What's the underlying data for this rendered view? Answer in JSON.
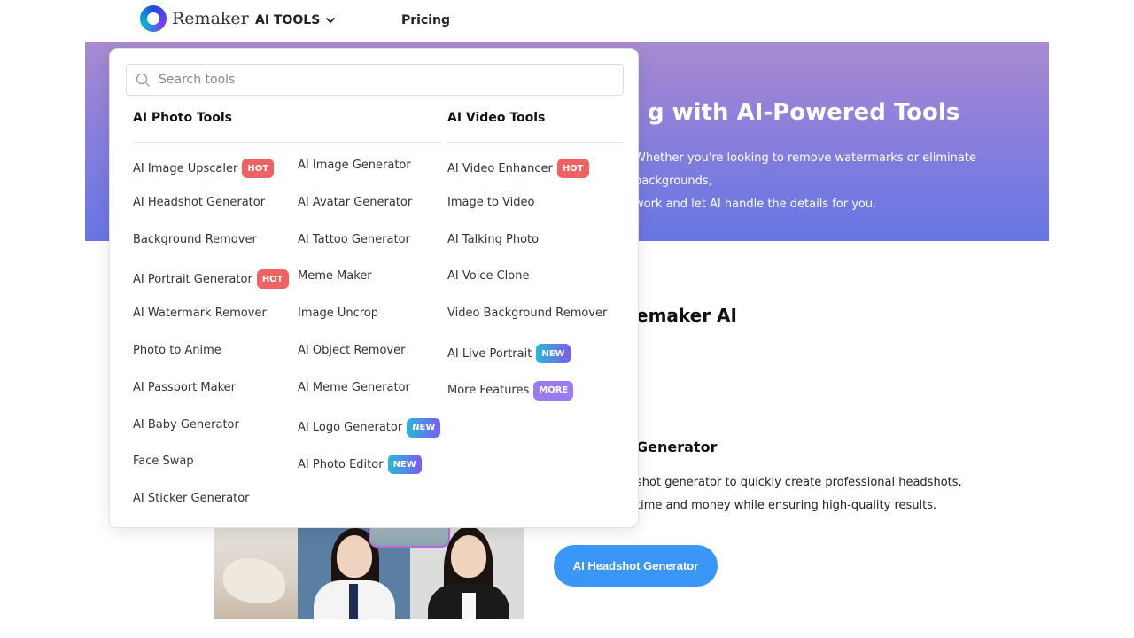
{
  "header": {
    "logo_text": "Remaker",
    "nav_tools": "AI TOOLS",
    "nav_pricing": "Pricing"
  },
  "hero": {
    "title": "g with AI-Powered Tools",
    "desc_line1": "Whether you're looking to remove watermarks or eliminate backgrounds,",
    "desc_line2": "work and let AI handle the details for you."
  },
  "section": {
    "title": "emaker AI",
    "sub_title": "Generator",
    "sub_desc_line1": "shot generator to quickly create professional headshots,",
    "sub_desc_line2": "time and money while ensuring high-quality results.",
    "cta_label": "AI Headshot Generator"
  },
  "dropdown": {
    "search_placeholder": "Search tools",
    "photo_heading": "AI Photo Tools",
    "video_heading": "AI Video Tools",
    "photo_col1": [
      {
        "label": "AI Image Upscaler",
        "badge": "HOT",
        "badge_type": "hot"
      },
      {
        "label": "AI Headshot Generator",
        "badge": "",
        "badge_type": ""
      },
      {
        "label": "Background Remover",
        "badge": "",
        "badge_type": ""
      },
      {
        "label": "AI Portrait Generator",
        "badge": "HOT",
        "badge_type": "hot"
      },
      {
        "label": "AI Watermark Remover",
        "badge": "",
        "badge_type": ""
      },
      {
        "label": "Photo to Anime",
        "badge": "",
        "badge_type": ""
      },
      {
        "label": "AI Passport Maker",
        "badge": "",
        "badge_type": ""
      },
      {
        "label": "AI Baby Generator",
        "badge": "",
        "badge_type": ""
      },
      {
        "label": "Face Swap",
        "badge": "",
        "badge_type": ""
      },
      {
        "label": "AI Sticker Generator",
        "badge": "",
        "badge_type": ""
      }
    ],
    "photo_col2": [
      {
        "label": "AI Image Generator",
        "badge": "",
        "badge_type": ""
      },
      {
        "label": "AI Avatar Generator",
        "badge": "",
        "badge_type": ""
      },
      {
        "label": "AI Tattoo Generator",
        "badge": "",
        "badge_type": ""
      },
      {
        "label": "Meme Maker",
        "badge": "",
        "badge_type": ""
      },
      {
        "label": "Image Uncrop",
        "badge": "",
        "badge_type": ""
      },
      {
        "label": "AI Object Remover",
        "badge": "",
        "badge_type": ""
      },
      {
        "label": "AI Meme Generator",
        "badge": "",
        "badge_type": ""
      },
      {
        "label": "AI Logo Generator",
        "badge": "NEW",
        "badge_type": "new"
      },
      {
        "label": "AI Photo Editor",
        "badge": "NEW",
        "badge_type": "new"
      }
    ],
    "video_col": [
      {
        "label": "AI Video Enhancer",
        "badge": "HOT",
        "badge_type": "hot"
      },
      {
        "label": "Image to Video",
        "badge": "",
        "badge_type": ""
      },
      {
        "label": "AI Talking Photo",
        "badge": "",
        "badge_type": ""
      },
      {
        "label": "AI Voice Clone",
        "badge": "",
        "badge_type": ""
      },
      {
        "label": "Video Background Remover",
        "badge": "",
        "badge_type": ""
      },
      {
        "label": "AI Live Portrait",
        "badge": "NEW",
        "badge_type": "new"
      },
      {
        "label": "More Features",
        "badge": "MORE",
        "badge_type": "more"
      }
    ]
  },
  "colors": {
    "accent": "#3b97f7",
    "hot": "#f06262",
    "new": "#27b8d8",
    "more": "#9b7cf0"
  }
}
